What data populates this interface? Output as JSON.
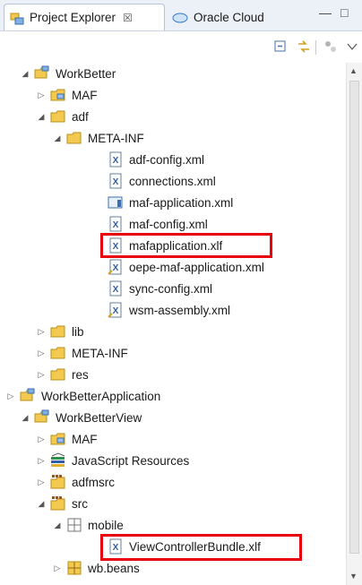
{
  "tabs": [
    {
      "label": "Project Explorer",
      "close": "☒"
    },
    {
      "label": "Oracle Cloud"
    }
  ],
  "window_buttons": {
    "minimize": "—",
    "maximize": "□"
  },
  "tree": [
    {
      "label": "WorkBetter",
      "icon": "project-folder-icon",
      "state": "expanded"
    },
    {
      "label": "MAF",
      "icon": "maf-folder-icon",
      "state": "collapsed"
    },
    {
      "label": "adf",
      "icon": "folder-icon",
      "state": "expanded"
    },
    {
      "label": "META-INF",
      "icon": "folder-icon",
      "state": "expanded"
    },
    {
      "label": "adf-config.xml",
      "icon": "xml-file-icon"
    },
    {
      "label": "connections.xml",
      "icon": "xml-file-icon"
    },
    {
      "label": "maf-application.xml",
      "icon": "maf-app-file-icon"
    },
    {
      "label": "maf-config.xml",
      "icon": "xml-file-icon"
    },
    {
      "label": "mafapplication.xlf",
      "icon": "xml-file-icon",
      "highlighted": true
    },
    {
      "label": "oepe-maf-application.xml",
      "icon": "xml-file-icon"
    },
    {
      "label": "sync-config.xml",
      "icon": "xml-file-icon"
    },
    {
      "label": "wsm-assembly.xml",
      "icon": "xml-file-icon"
    },
    {
      "label": "lib",
      "icon": "folder-icon",
      "state": "collapsed"
    },
    {
      "label": "META-INF",
      "icon": "folder-icon",
      "state": "collapsed"
    },
    {
      "label": "res",
      "icon": "folder-icon",
      "state": "collapsed"
    },
    {
      "label": "WorkBetterApplication",
      "icon": "project-folder-icon",
      "state": "collapsed"
    },
    {
      "label": "WorkBetterView",
      "icon": "project-folder-icon",
      "state": "expanded"
    },
    {
      "label": "MAF",
      "icon": "maf-folder-icon",
      "state": "collapsed"
    },
    {
      "label": "JavaScript Resources",
      "icon": "javascript-resources-icon",
      "state": "collapsed"
    },
    {
      "label": "adfmsrc",
      "icon": "source-folder-icon",
      "state": "collapsed"
    },
    {
      "label": "src",
      "icon": "source-folder-icon",
      "state": "expanded"
    },
    {
      "label": "mobile",
      "icon": "package-icon",
      "state": "expanded"
    },
    {
      "label": "ViewControllerBundle.xlf",
      "icon": "xml-file-icon",
      "highlighted": true
    },
    {
      "label": "wb.beans",
      "icon": "package-icon",
      "state": "collapsed"
    }
  ],
  "colors": {
    "highlight": "#e8000d",
    "folder": "#f3c94f",
    "xml": "#2d5fa8"
  }
}
